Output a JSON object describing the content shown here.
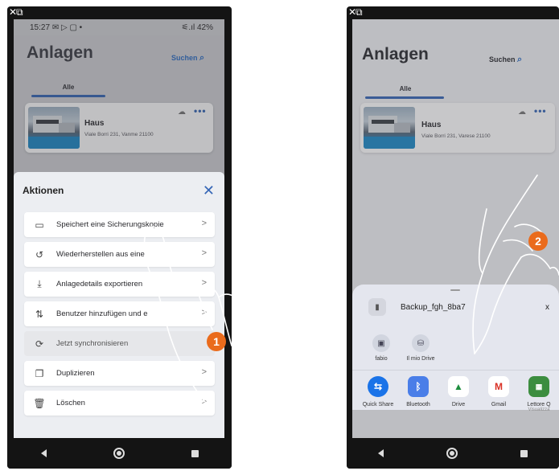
{
  "overlay_icons": "✕⧉",
  "screen1": {
    "status": {
      "time": "15:27",
      "notifications": "✉ ▷ ▢ •",
      "signal": "⚟.ıl",
      "battery": "42%"
    },
    "app_title": "Anlagen",
    "search_label": "Suchen",
    "tab_label": "Alle",
    "card": {
      "name": "Haus",
      "address": "Viale Borri 231, Vanme 21100"
    },
    "sheet": {
      "title": "Aktionen",
      "actions": [
        {
          "icon": "save-icon",
          "label": "Speichert eine Sicherungskopie"
        },
        {
          "icon": "restore-icon",
          "label": "Wiederherstellen aus eine"
        },
        {
          "icon": "export-icon",
          "label": "Anlagedetails exportieren"
        },
        {
          "icon": "add-users-icon",
          "label": "Benutzer hinzufügen und e"
        },
        {
          "icon": "sync-icon",
          "label": "Jetzt synchronisieren"
        },
        {
          "icon": "duplicate-icon",
          "label": "Duplizieren"
        },
        {
          "icon": "trash-icon",
          "label": "Löschen"
        }
      ]
    },
    "badge": "1"
  },
  "screen2": {
    "app_title": "Anlagen",
    "search_label": "Suchen",
    "tab_label": "Alle",
    "card": {
      "name": "Haus",
      "address": "Viale Borri 231, Varese 21100"
    },
    "share": {
      "file_name": "Backup_fgh_8ba7",
      "file_ext": "x",
      "quick_targets": [
        {
          "icon": "contact-icon",
          "label": "fabio"
        },
        {
          "icon": "drive-folder-icon",
          "label": "Il mio Drive"
        }
      ],
      "apps": [
        {
          "icon": "quick-share-icon",
          "label": "Quick Share",
          "color": "#1a73e8"
        },
        {
          "icon": "bluetooth-icon",
          "label": "Bluetooth",
          "color": "#4a7ee8"
        },
        {
          "icon": "drive-icon",
          "label": "Drive",
          "color": "#ffffff"
        },
        {
          "icon": "gmail-icon",
          "label": "Gmail",
          "color": "#ffffff"
        },
        {
          "icon": "qr-reader-icon",
          "label": "Lettore Q",
          "sublabel": "Visualizza",
          "color": "#3c8d3f"
        }
      ]
    },
    "badge": "2"
  }
}
